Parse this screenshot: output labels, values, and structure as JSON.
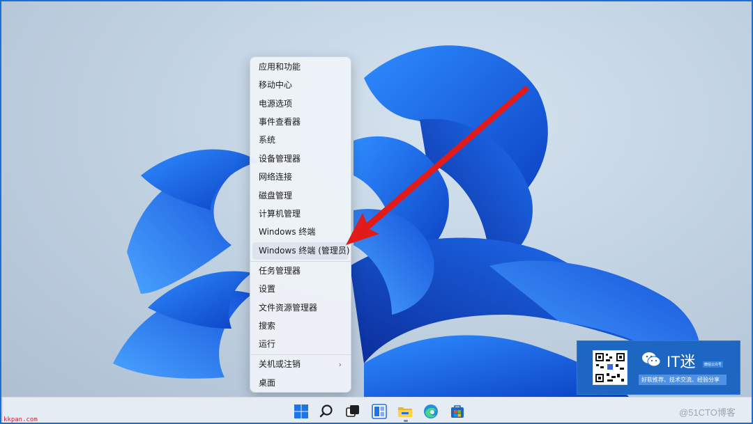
{
  "context_menu": {
    "items": [
      {
        "label": "应用和功能"
      },
      {
        "label": "移动中心"
      },
      {
        "label": "电源选项"
      },
      {
        "label": "事件查看器"
      },
      {
        "label": "系统"
      },
      {
        "label": "设备管理器"
      },
      {
        "label": "网络连接"
      },
      {
        "label": "磁盘管理"
      },
      {
        "label": "计算机管理"
      },
      {
        "label": "Windows 终端"
      },
      {
        "label": "Windows 终端 (管理员)"
      },
      {
        "label": "任务管理器"
      },
      {
        "label": "设置"
      },
      {
        "label": "文件资源管理器"
      },
      {
        "label": "搜索"
      },
      {
        "label": "运行"
      },
      {
        "label": "关机或注销"
      },
      {
        "label": "桌面"
      }
    ],
    "submenu_chevron": "›",
    "highlighted_item": "Windows 终端 (管理员)"
  },
  "taskbar": {
    "icons": [
      "start-icon",
      "search-icon",
      "task-view-icon",
      "widgets-icon",
      "file-explorer-icon",
      "edge-icon",
      "store-icon"
    ]
  },
  "it_badge": {
    "title": "IT迷",
    "small_tag": "微信公众号",
    "bar_text": "好软推荐、技术交流、经验分享"
  },
  "watermarks": {
    "left": "kkpan.com",
    "right": "@51CTO博客"
  },
  "colors": {
    "frame_border": "#1a6fd0",
    "arrow": "#e11a1a",
    "badge": "#1d66c2"
  }
}
